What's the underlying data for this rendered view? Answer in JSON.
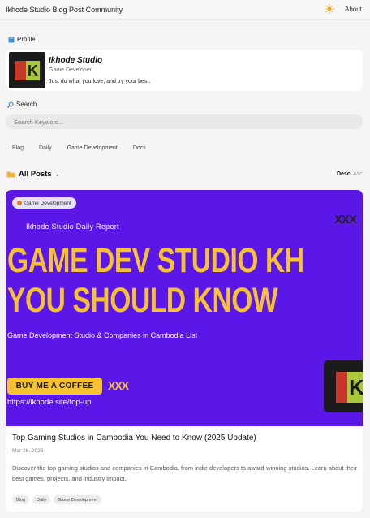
{
  "header": {
    "site_title": "Ikhode Studio Blog Post Community",
    "about_label": "About",
    "theme_icon": "sun-icon"
  },
  "profile": {
    "section_label": "Profile",
    "name": "Ikhode Studio",
    "role": "Game Developer",
    "bio": "Just do what you love, and try your best.",
    "logo_letter": "K"
  },
  "search": {
    "section_label": "Search",
    "placeholder": "Search Keyword..."
  },
  "categories": [
    "Blog",
    "Daily",
    "Game Development",
    "Docs"
  ],
  "posts_header": {
    "label": "All Posts",
    "sort_desc": "Desc",
    "sort_asc": "Asc"
  },
  "post": {
    "category_badge": "Game Development",
    "banner": {
      "subtitle": "Ikhode Studio Daily Report",
      "mark": "XXX",
      "headline_1": "GAME DEV STUDIO KH",
      "headline_2": "YOU SHOULD KNOW",
      "description": "Game Development Studio & Companies in Cambodia List",
      "button_label": "BUY ME A COFFEE",
      "button_mark": "XXX",
      "url": "https://ikhode.site/top-up",
      "logo_letter": "K"
    },
    "title": "Top Gaming Studios in Cambodia You Need to Know (2025 Update)",
    "date": "Mar 26, 2025",
    "excerpt": "Discover the top gaming studios and companies in Cambodia, from indie developers to award-winning studios. Learn about their best games, projects, and industry impact.",
    "tags": [
      "Blog",
      "Daily",
      "Game Development"
    ]
  },
  "colors": {
    "banner_bg": "#5b17e8",
    "accent_yellow": "#f6c233",
    "logo_red": "#c6362b",
    "logo_green": "#a9c93b"
  }
}
